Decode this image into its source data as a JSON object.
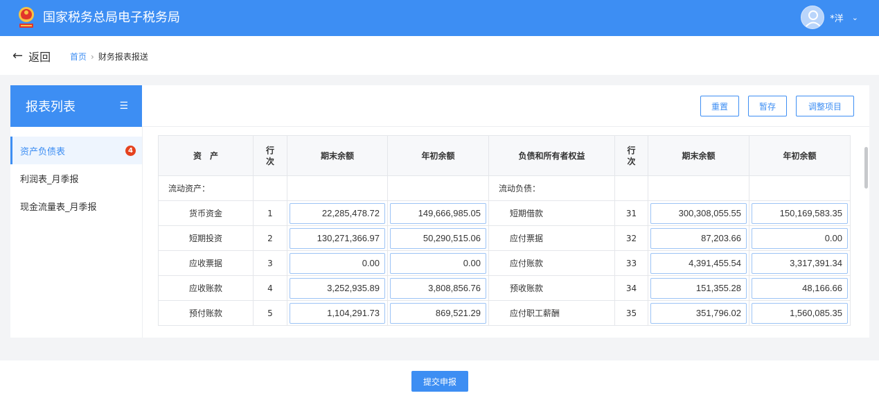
{
  "header": {
    "app_title": "国家税务总局电子税务局",
    "user_name": "*洋",
    "caret": "⌄"
  },
  "breadcrumb": {
    "back_label": "返回",
    "home": "首页",
    "separator": "›",
    "current": "财务报表报送"
  },
  "sidebar": {
    "title": "报表列表",
    "items": [
      {
        "label": "资产负债表",
        "badge": "4",
        "active": true
      },
      {
        "label": "利润表_月季报"
      },
      {
        "label": "现金流量表_月季报"
      }
    ]
  },
  "toolbar": {
    "reset": "重置",
    "save": "暂存",
    "adjust": "调整项目"
  },
  "table": {
    "headers": [
      "资　产",
      "行\n次",
      "期末余额",
      "年初余额",
      "负债和所有者权益",
      "行\n次",
      "期末余额",
      "年初余额"
    ],
    "section_left": "流动资产：",
    "section_right": "流动负债：",
    "rows": [
      {
        "asset": "货币资金",
        "row_l": "1",
        "end_l": "22,285,478.72",
        "begin_l": "149,666,985.05",
        "liab": "短期借款",
        "row_r": "31",
        "end_r": "300,308,055.55",
        "begin_r": "150,169,583.35"
      },
      {
        "asset": "短期投资",
        "row_l": "2",
        "end_l": "130,271,366.97",
        "begin_l": "50,290,515.06",
        "liab": "应付票据",
        "row_r": "32",
        "end_r": "87,203.66",
        "begin_r": "0.00"
      },
      {
        "asset": "应收票据",
        "row_l": "3",
        "end_l": "0.00",
        "begin_l": "0.00",
        "liab": "应付账款",
        "row_r": "33",
        "end_r": "4,391,455.54",
        "begin_r": "3,317,391.34"
      },
      {
        "asset": "应收账款",
        "row_l": "4",
        "end_l": "3,252,935.89",
        "begin_l": "3,808,856.76",
        "liab": "预收账款",
        "row_r": "34",
        "end_r": "151,355.28",
        "begin_r": "48,166.66"
      },
      {
        "asset": "预付账款",
        "row_l": "5",
        "end_l": "1,104,291.73",
        "begin_l": "869,521.29",
        "liab": "应付职工薪酬",
        "row_r": "35",
        "end_r": "351,796.02",
        "begin_r": "1,560,085.35"
      }
    ]
  },
  "footer": {
    "submit": "提交申报"
  },
  "colors": {
    "primary": "#3d8ef3",
    "badge": "#e5421f",
    "band": "#f3f4f6"
  }
}
